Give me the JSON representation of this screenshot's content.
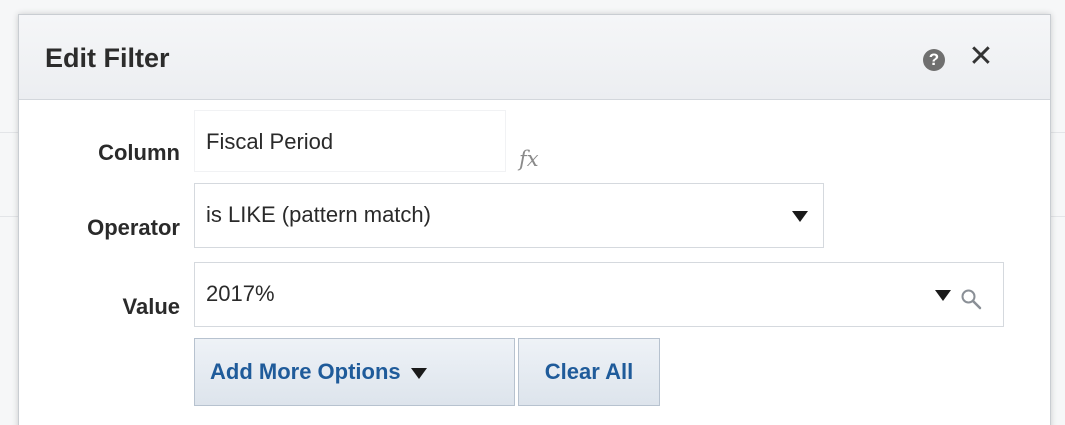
{
  "dialog": {
    "title": "Edit Filter",
    "help_icon": "help-icon",
    "help_glyph": "?",
    "close_icon": "close-icon",
    "close_glyph": "✕"
  },
  "form": {
    "column": {
      "label": "Column",
      "value": "Fiscal Period",
      "formula_icon": "fx-icon",
      "formula_glyph": "fx"
    },
    "operator": {
      "label": "Operator",
      "selected": "is LIKE (pattern match)",
      "dropdown_icon": "chevron-down-icon"
    },
    "value": {
      "label": "Value",
      "value": "2017%",
      "dropdown_icon": "chevron-down-icon",
      "search_icon": "search-icon"
    }
  },
  "buttons": {
    "add_more_options": "Add More Options",
    "clear_all": "Clear All"
  },
  "colors": {
    "header_bg": "#eceef1",
    "button_text": "#1f5b9a",
    "button_bg": "#dde4ec",
    "label_text": "#2a2a2a",
    "field_border": "#d5d9de"
  }
}
